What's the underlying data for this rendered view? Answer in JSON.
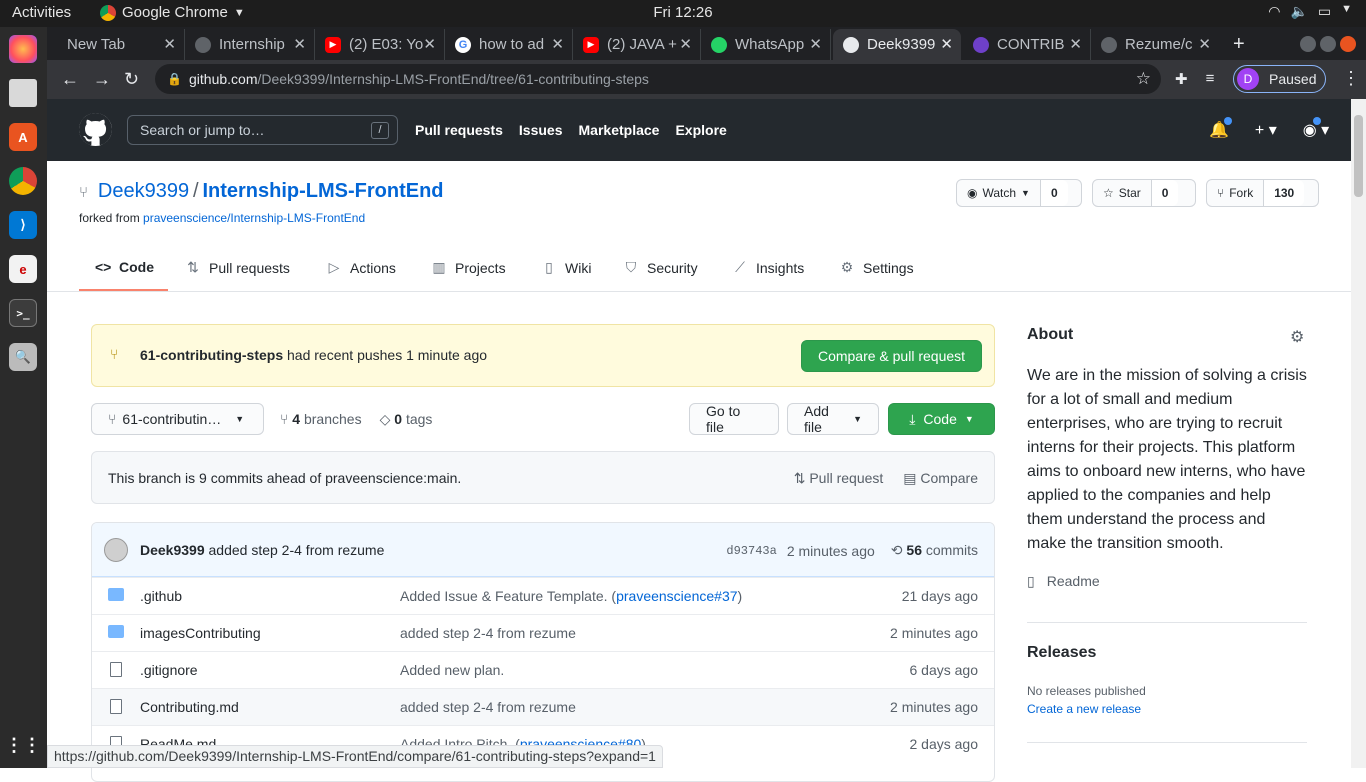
{
  "os": {
    "activities": "Activities",
    "app_menu": "Google Chrome",
    "clock": "Fri 12:26"
  },
  "browser": {
    "tabs": [
      {
        "title": "New Tab",
        "favicon_color": "#202124"
      },
      {
        "title": "Internship",
        "favicon_color": "#5f6368"
      },
      {
        "title": "(2) E03: Yo",
        "favicon_color": "#ff0000"
      },
      {
        "title": "how to ad",
        "favicon_color": "#4285f4"
      },
      {
        "title": "(2) JAVA +",
        "favicon_color": "#ff0000"
      },
      {
        "title": "WhatsApp",
        "favicon_color": "#25d366"
      },
      {
        "title": "Deek9399",
        "favicon_color": "#5f6368"
      },
      {
        "title": "CONTRIB",
        "favicon_color": "#6e40c9"
      },
      {
        "title": "Rezume/c",
        "favicon_color": "#5f6368"
      }
    ],
    "url_host": "github.com",
    "url_path": "/Deek9399/Internship-LMS-FrontEnd/tree/61-contributing-steps",
    "profile_initial": "D",
    "profile_status": "Paused",
    "status_url": "https://github.com/Deek9399/Internship-LMS-FrontEnd/compare/61-contributing-steps?expand=1"
  },
  "github_header": {
    "search_placeholder": "Search or jump to…",
    "search_key": "/",
    "nav": [
      "Pull requests",
      "Issues",
      "Marketplace",
      "Explore"
    ]
  },
  "repo": {
    "owner": "Deek9399",
    "separator": "/",
    "name": "Internship-LMS-FrontEnd",
    "forked_prefix": "forked from ",
    "forked_from": "praveenscience/Internship-LMS-FrontEnd",
    "watch": {
      "label": "Watch",
      "count": "0"
    },
    "star": {
      "label": "Star",
      "count": "0"
    },
    "fork": {
      "label": "Fork",
      "count": "130"
    }
  },
  "repo_tabs": [
    {
      "label": "Code",
      "icon": "code-icon"
    },
    {
      "label": "Pull requests",
      "icon": "pull-request-icon"
    },
    {
      "label": "Actions",
      "icon": "play-icon"
    },
    {
      "label": "Projects",
      "icon": "project-icon"
    },
    {
      "label": "Wiki",
      "icon": "book-icon"
    },
    {
      "label": "Security",
      "icon": "shield-icon"
    },
    {
      "label": "Insights",
      "icon": "graph-icon"
    },
    {
      "label": "Settings",
      "icon": "gear-icon"
    }
  ],
  "banner": {
    "branch": "61-contributing-steps",
    "text": " had recent pushes 1 minute ago",
    "button": "Compare & pull request"
  },
  "file_nav": {
    "branch_select": "61-contributin…",
    "branches_count": "4",
    "branches_label": "branches",
    "tags_count": "0",
    "tags_label": "tags",
    "go_to_file": "Go to file",
    "add_file": "Add file",
    "code": "Code"
  },
  "ahead": {
    "text": "This branch is 9 commits ahead of praveenscience:main.",
    "pull_request": "Pull request",
    "compare": "Compare"
  },
  "latest_commit": {
    "author": "Deek9399",
    "message": " added step 2-4 from rezume",
    "sha": "d93743a",
    "age": "2 minutes ago",
    "commits_count": "56",
    "commits_label": "commits"
  },
  "files": [
    {
      "type": "dir",
      "name": ".github",
      "msg": "Added Issue & Feature Template. (",
      "link": "praveenscience#37",
      "msg_end": ")",
      "age": "21 days ago"
    },
    {
      "type": "dir",
      "name": "imagesContributing",
      "msg": "added step 2-4 from rezume",
      "link": "",
      "msg_end": "",
      "age": "2 minutes ago"
    },
    {
      "type": "file",
      "name": ".gitignore",
      "msg": "Added new plan.",
      "link": "",
      "msg_end": "",
      "age": "6 days ago"
    },
    {
      "type": "file",
      "name": "Contributing.md",
      "msg": "added step 2-4 from rezume",
      "link": "",
      "msg_end": "",
      "age": "2 minutes ago"
    },
    {
      "type": "file",
      "name": "ReadMe.md",
      "msg": "Added Intro Pitch. (",
      "link": "praveenscience#80",
      "msg_end": ")",
      "age": "2 days ago"
    }
  ],
  "about": {
    "heading": "About",
    "description": "We are in the mission of solving a crisis for a lot of small and medium enterprises, who are trying to recruit interns for their projects. This platform aims to onboard new interns, who have applied to the companies and help them understand the process and make the transition smooth.",
    "readme": "Readme"
  },
  "releases": {
    "heading": "Releases",
    "none": "No releases published",
    "create": "Create a new release"
  }
}
